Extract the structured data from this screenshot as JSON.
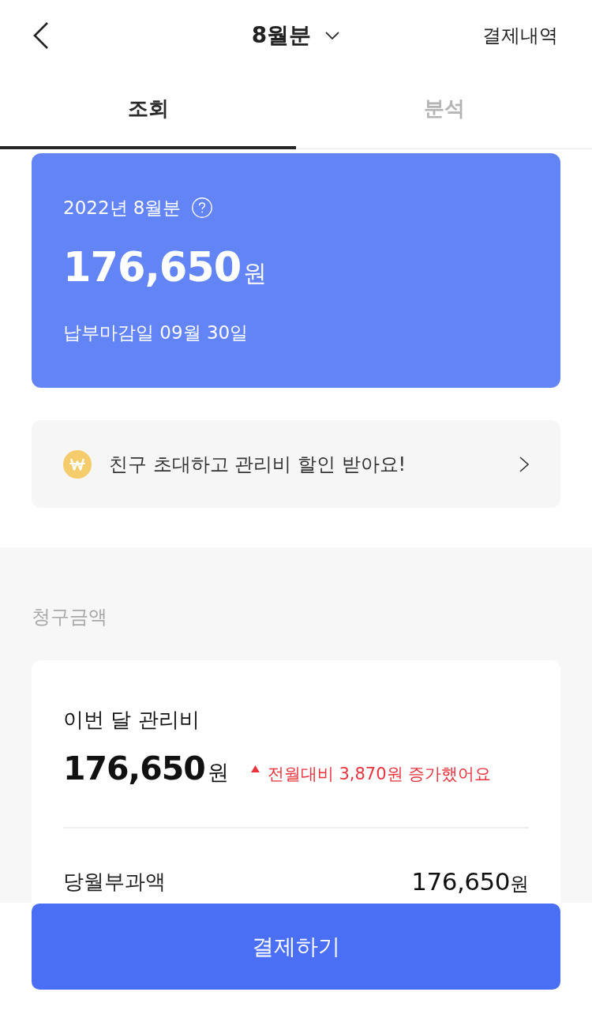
{
  "header": {
    "title": "8월분",
    "action": "결제내역"
  },
  "tabs": [
    {
      "label": "조회",
      "selected": true
    },
    {
      "label": "분석",
      "selected": false
    }
  ],
  "bill_card": {
    "period": "2022년 8월분",
    "amount": "176,650",
    "unit": "원",
    "due": "납부마감일 09월 30일"
  },
  "promo": {
    "text": "친구 초대하고 관리비 할인 받아요!"
  },
  "section": {
    "title": "청구금액"
  },
  "summary_card": {
    "title": "이번 달 관리비",
    "amount": "176,650",
    "unit": "원",
    "change": {
      "increased": true,
      "text": "전월대비 3,870원 증가했어요"
    },
    "rows": [
      {
        "label": "당월부과액",
        "amount": "176,650",
        "unit": "원"
      }
    ]
  },
  "pay_button": {
    "label": "결제하기"
  }
}
